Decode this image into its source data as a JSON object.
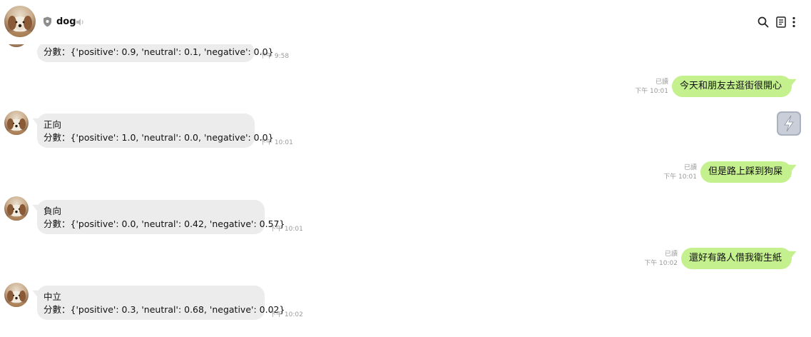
{
  "header": {
    "title": "dog",
    "icons": [
      "shield-icon",
      "speaker-icon",
      "search-icon",
      "notes-icon",
      "more-icon"
    ]
  },
  "messages": [
    {
      "side": "in",
      "lines": [
        "分數：{'positive': 0.9, 'neutral': 0.1, 'negative': 0.0}"
      ],
      "time": "下午 9:58"
    },
    {
      "side": "out",
      "text": "今天和朋友去逛街很開心",
      "read": "已讀",
      "time": "下午 10:01"
    },
    {
      "side": "in",
      "lines": [
        "正向",
        "分數：{'positive': 1.0, 'neutral': 0.0, 'negative': 0.0}"
      ],
      "time": "下午 10:01"
    },
    {
      "side": "out",
      "text": "但是路上踩到狗屎",
      "read": "已讀",
      "time": "下午 10:01"
    },
    {
      "side": "in",
      "lines": [
        "負向",
        "分數：{'positive': 0.0, 'neutral': 0.42, 'negative': 0.57}"
      ],
      "time": "下午 10:01"
    },
    {
      "side": "out",
      "text": "還好有路人借我衛生紙",
      "read": "已讀",
      "time": "下午 10:02"
    },
    {
      "side": "in",
      "lines": [
        "中立",
        "分數：{'positive': 0.3, 'neutral': 0.68, 'negative': 0.02}"
      ],
      "time": "下午 10:02"
    }
  ],
  "colors": {
    "outgoing_bubble": "#c4f08e",
    "incoming_bubble": "#ececec",
    "meta_text": "#9a9a9a"
  }
}
